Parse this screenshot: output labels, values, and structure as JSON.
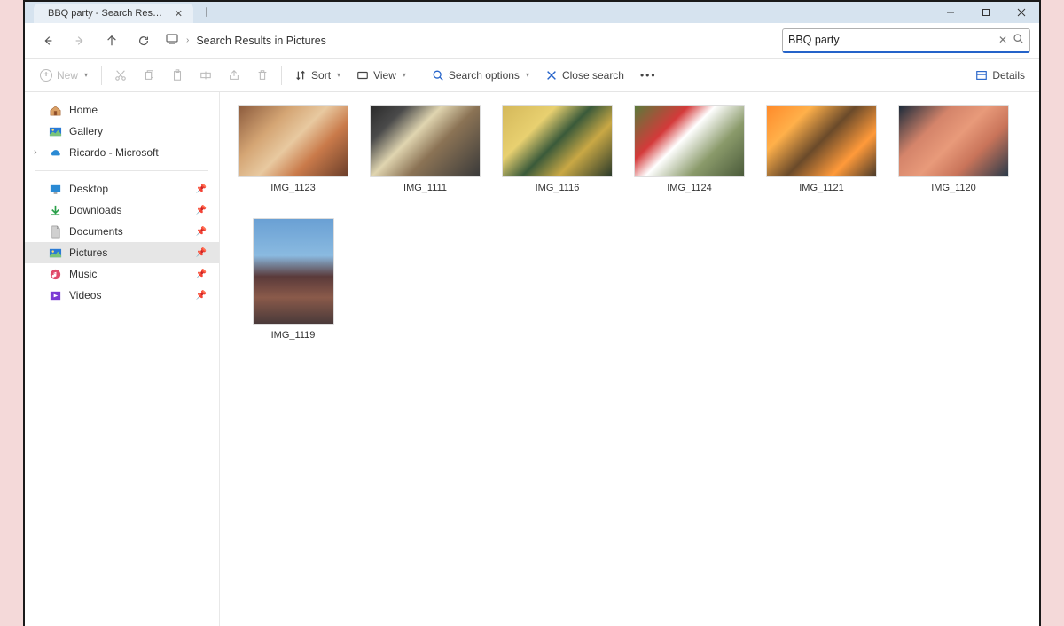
{
  "tab": {
    "title": "BBQ party - Search Results in I"
  },
  "address": {
    "path": "Search Results in Pictures"
  },
  "search": {
    "query": "BBQ party"
  },
  "toolbar": {
    "new": "New",
    "sort": "Sort",
    "view": "View",
    "search_options": "Search options",
    "close_search": "Close search",
    "details": "Details"
  },
  "sidebar": {
    "home": "Home",
    "gallery": "Gallery",
    "account": "Ricardo - Microsoft",
    "desktop": "Desktop",
    "downloads": "Downloads",
    "documents": "Documents",
    "pictures": "Pictures",
    "music": "Music",
    "videos": "Videos"
  },
  "files": [
    {
      "name": "IMG_1123",
      "shape": "wide",
      "g": "g0"
    },
    {
      "name": "IMG_1111",
      "shape": "wide",
      "g": "g1"
    },
    {
      "name": "IMG_1116",
      "shape": "wide",
      "g": "g2"
    },
    {
      "name": "IMG_1124",
      "shape": "wide",
      "g": "g3"
    },
    {
      "name": "IMG_1121",
      "shape": "wide",
      "g": "g4"
    },
    {
      "name": "IMG_1120",
      "shape": "wide",
      "g": "g5"
    },
    {
      "name": "IMG_1119",
      "shape": "tall",
      "g": "g6"
    }
  ]
}
